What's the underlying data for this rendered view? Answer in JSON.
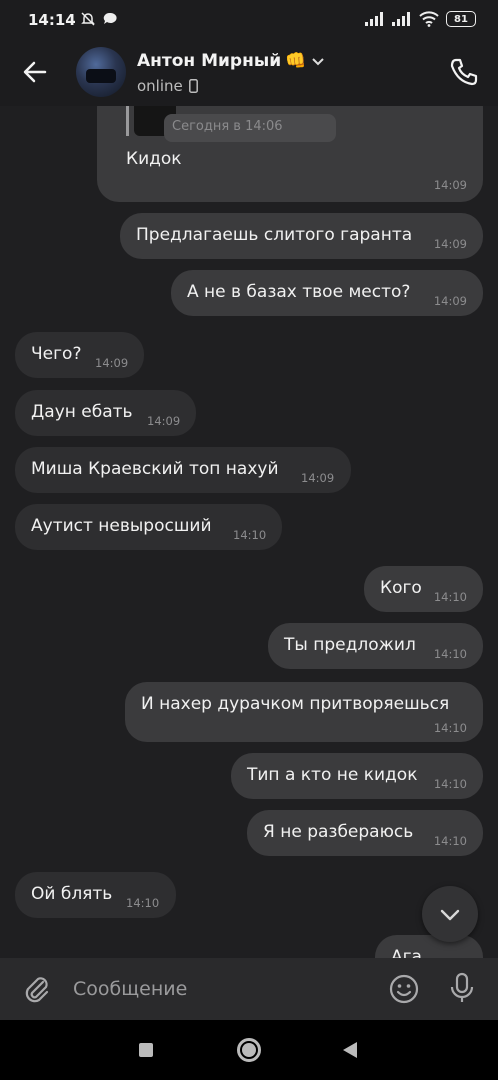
{
  "status_bar": {
    "time": "14:14",
    "battery": "81"
  },
  "header": {
    "name": "Антон Мирный",
    "name_emoji": "👊",
    "status": "online"
  },
  "quote": {
    "date_text": "Сегодня в 14:06",
    "text": "Кидок",
    "time": "14:09"
  },
  "messages": [
    {
      "text": "Предлагаешь слитого гаранта",
      "time": "14:09",
      "side": "out"
    },
    {
      "text": "А не в базах твое место?",
      "time": "14:09",
      "side": "out"
    },
    {
      "text": "Чего?",
      "time": "14:09",
      "side": "in"
    },
    {
      "text": "Даун ебать",
      "time": "14:09",
      "side": "in"
    },
    {
      "text": "Миша Краевский топ нахуй",
      "time": "14:09",
      "side": "in"
    },
    {
      "text": "Аутист невыросший",
      "time": "14:10",
      "side": "in"
    },
    {
      "text": "Кого",
      "time": "14:10",
      "side": "out"
    },
    {
      "text": "Ты предложил",
      "time": "14:10",
      "side": "out"
    },
    {
      "text": "И нахер дурачком притворяешься",
      "time": "14:10",
      "side": "out"
    },
    {
      "text": "Тип а кто не кидок",
      "time": "14:10",
      "side": "out"
    },
    {
      "text": "Я не разбераюсь",
      "time": "14:10",
      "side": "out"
    },
    {
      "text": "Ой блять",
      "time": "14:10",
      "side": "in"
    },
    {
      "text": "Ага",
      "time": "",
      "side": "out"
    }
  ],
  "composer": {
    "placeholder": "Сообщение"
  },
  "icons": {
    "back": "arrow-left-icon",
    "call": "phone-icon",
    "attach": "paperclip-icon",
    "emoji": "smiley-icon",
    "mic": "microphone-icon",
    "scroll_down": "chevron-down-icon"
  }
}
